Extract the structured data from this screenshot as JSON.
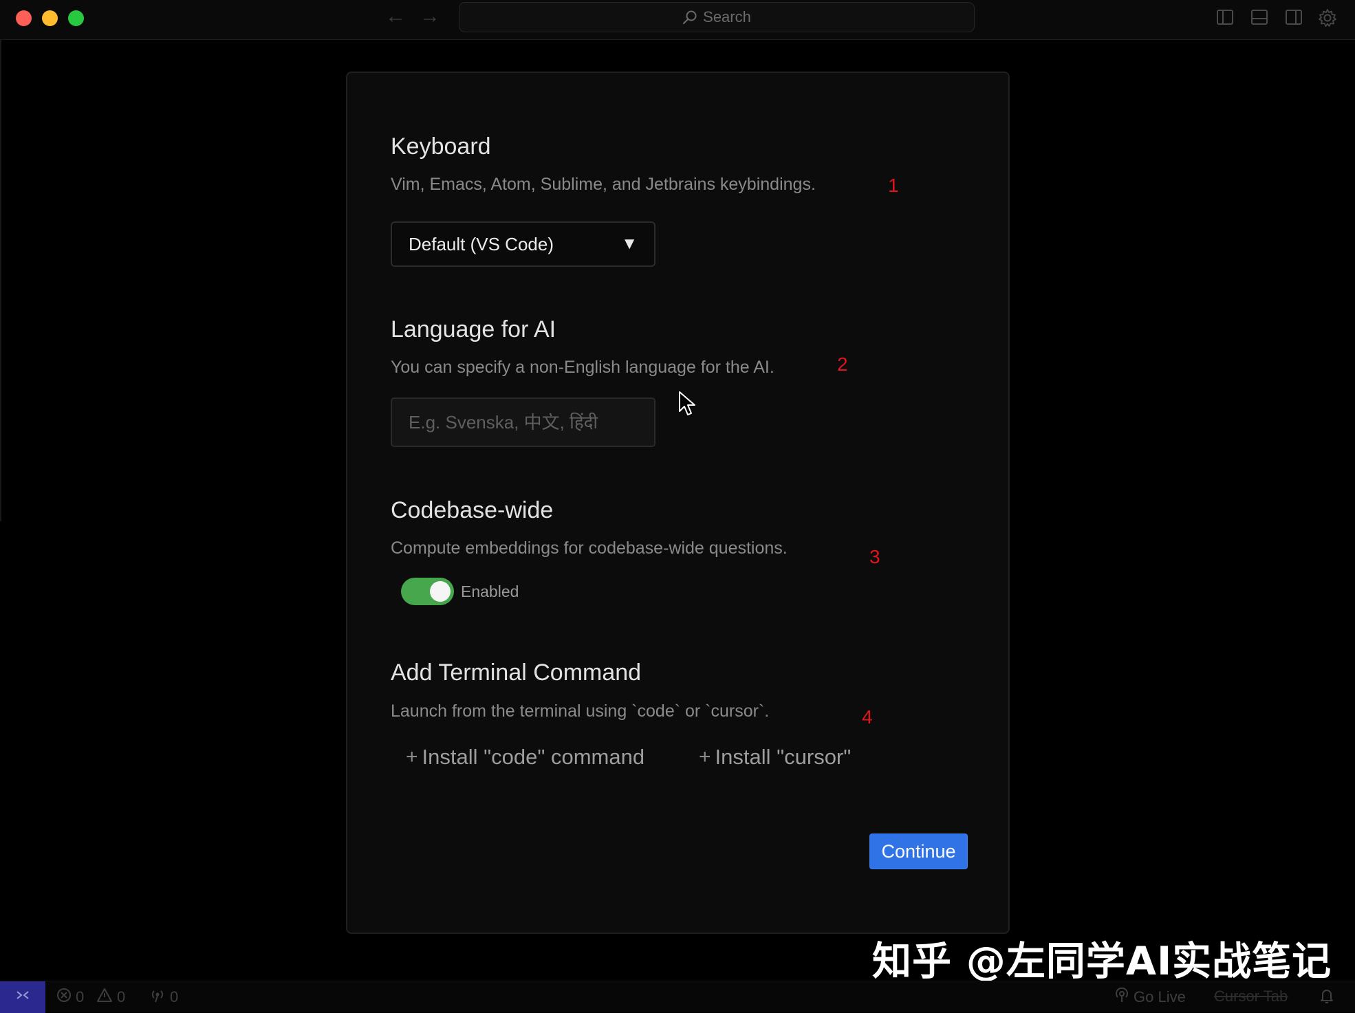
{
  "titlebar": {
    "search_label": "Search",
    "icons": [
      "back-arrow-icon",
      "forward-arrow-icon",
      "search-icon",
      "toggle-primary-sidebar-icon",
      "toggle-panel-icon",
      "toggle-secondary-sidebar-icon",
      "settings-gear-icon"
    ]
  },
  "dialog": {
    "keyboard": {
      "title": "Keyboard",
      "description": "Vim, Emacs, Atom, Sublime, and Jetbrains keybindings.",
      "selected": "Default (VS Code)",
      "caret": "▼",
      "marker": "1"
    },
    "language": {
      "title": "Language for AI",
      "description": "You can specify a non-English language for the AI.",
      "placeholder": "E.g. Svenska, 中文, हिंदी",
      "value": "",
      "marker": "2"
    },
    "codebase": {
      "title": "Codebase-wide",
      "description": "Compute embeddings for codebase-wide questions.",
      "toggle_label": "Enabled",
      "toggle_on": true,
      "marker": "3"
    },
    "terminal": {
      "title": "Add Terminal Command",
      "description": "Launch from the terminal using `code` or `cursor`.",
      "install_code_label": "Install \"code\" command",
      "install_cursor_label": "Install \"cursor\"",
      "plus": "+",
      "marker": "4"
    },
    "continue_label": "Continue"
  },
  "watermark": "知乎 @左同学AI实战笔记",
  "statusbar": {
    "errors": "0",
    "warnings": "0",
    "ports": "0",
    "golive": "Go Live",
    "cursor_tab": "Cursor Tab"
  },
  "colors": {
    "accent": "#2f73e6",
    "toggle_on": "#46a74d",
    "marker_red": "#e0141b",
    "remote_purple": "#2b2990"
  }
}
